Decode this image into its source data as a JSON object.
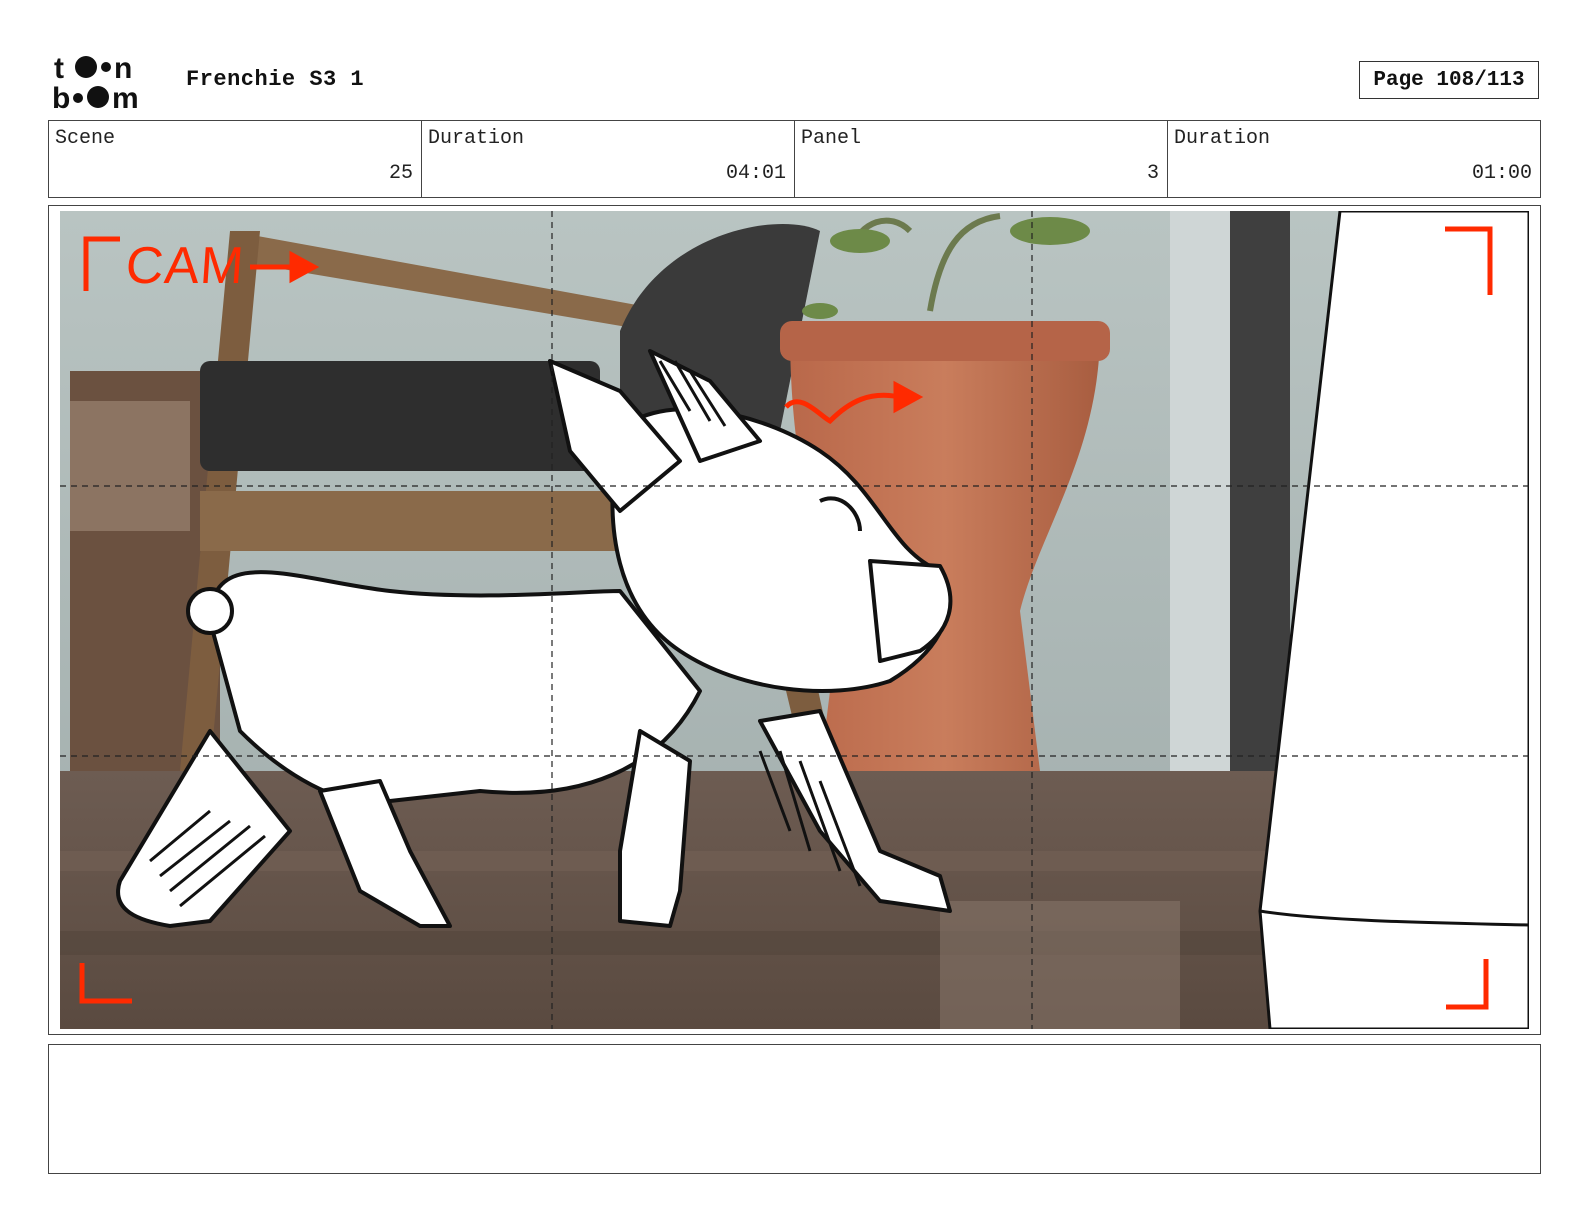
{
  "header": {
    "logo_text": "toon boom",
    "project_title": "Frenchie S3 1",
    "page_label": "Page 108/113"
  },
  "info": {
    "scene_label": "Scene",
    "scene_value": "25",
    "scene_duration_label": "Duration",
    "scene_duration_value": "04:01",
    "panel_label": "Panel",
    "panel_value": "3",
    "panel_duration_label": "Duration",
    "panel_duration_value": "01:00"
  },
  "panel": {
    "cam_annotation": "CAM",
    "annotation_color": "#ff2a00"
  },
  "notes": {
    "text": ""
  }
}
